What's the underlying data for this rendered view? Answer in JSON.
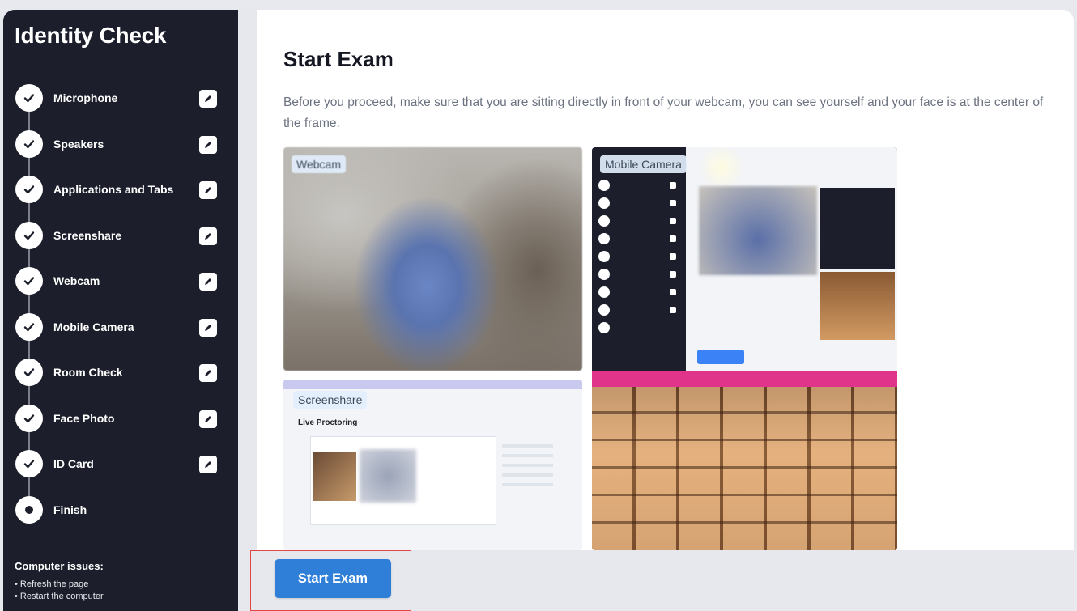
{
  "sidebar": {
    "title": "Identity Check",
    "steps": [
      {
        "label": "Microphone",
        "status": "done"
      },
      {
        "label": "Speakers",
        "status": "done"
      },
      {
        "label": "Applications and Tabs",
        "status": "done"
      },
      {
        "label": "Screenshare",
        "status": "done"
      },
      {
        "label": "Webcam",
        "status": "done"
      },
      {
        "label": "Mobile Camera",
        "status": "done"
      },
      {
        "label": "Room Check",
        "status": "done"
      },
      {
        "label": "Face Photo",
        "status": "done"
      },
      {
        "label": "ID Card",
        "status": "done"
      },
      {
        "label": "Finish",
        "status": "current"
      }
    ],
    "issues_title": "Computer issues:",
    "issues": [
      "Refresh the page",
      "Restart the computer"
    ]
  },
  "main": {
    "title": "Start Exam",
    "description": "Before you proceed, make sure that you are sitting directly in front of your webcam, you can see yourself and your face is at the center of the frame.",
    "feeds": {
      "webcam_label": "Webcam",
      "screenshare_label": "Screenshare",
      "screenshare_title": "Live Proctoring",
      "mobile_label": "Mobile Camera"
    },
    "start_button": "Start Exam"
  },
  "colors": {
    "sidebar_bg": "#1c1f2b",
    "accent": "#2f7fd8",
    "highlight_border": "#e04848"
  }
}
